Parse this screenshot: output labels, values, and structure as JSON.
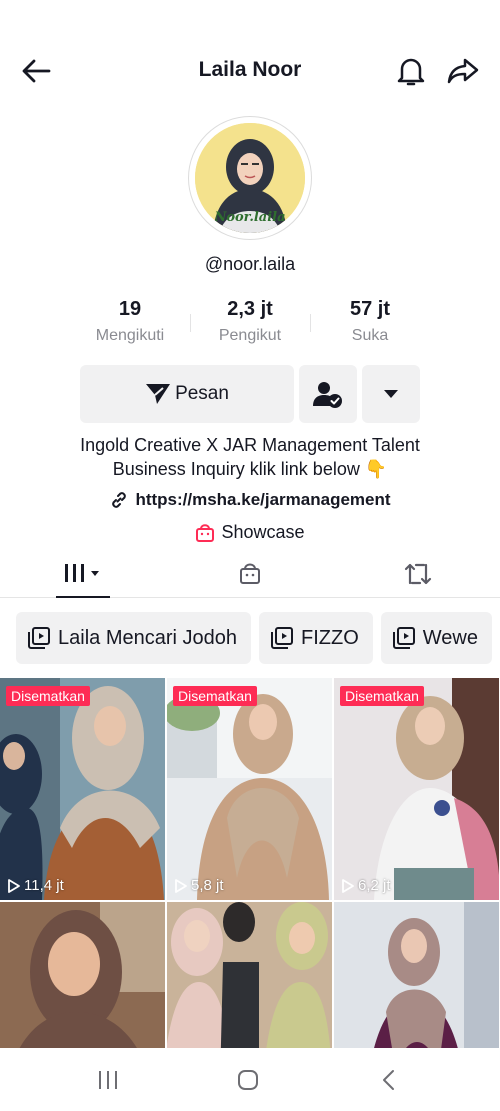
{
  "header": {
    "title": "Laila Noor",
    "icons": [
      "back-arrow-icon",
      "bell-icon",
      "share-icon"
    ]
  },
  "profile": {
    "avatar_text": "Noor.laila",
    "handle": "@noor.laila"
  },
  "stats": [
    {
      "value": "19",
      "label": "Mengikuti"
    },
    {
      "value": "2,3 jt",
      "label": "Pengikut"
    },
    {
      "value": "57 jt",
      "label": "Suka"
    }
  ],
  "actions": {
    "message_label": "Pesan",
    "icons": [
      "send-icon",
      "friend-check-icon",
      "caret-down-icon"
    ]
  },
  "bio": {
    "line1": "Ingold Creative X JAR Management Talent",
    "line2": "Business Inquiry klik link below 👇",
    "link": "https://msha.ke/jarmanagement",
    "showcase": "Showcase"
  },
  "tabs": [
    "videos-grid-icon",
    "shop-bag-icon",
    "repost-icon"
  ],
  "playlists": [
    {
      "label": "Laila Mencari Jodoh"
    },
    {
      "label": "FIZZO"
    },
    {
      "label": "Wewe"
    }
  ],
  "videos": [
    {
      "pinned": "Disematkan",
      "views": "11,4 jt"
    },
    {
      "pinned": "Disematkan",
      "views": "5,8 jt"
    },
    {
      "pinned": "Disematkan",
      "views": "6,2 jt"
    },
    {
      "pinned": "",
      "views": ""
    },
    {
      "pinned": "",
      "views": ""
    },
    {
      "pinned": "",
      "views": ""
    }
  ],
  "colors": {
    "accent": "#fe2c55",
    "text": "#161823",
    "muted": "#8a8b91",
    "button_bg": "#f1f1f2"
  }
}
